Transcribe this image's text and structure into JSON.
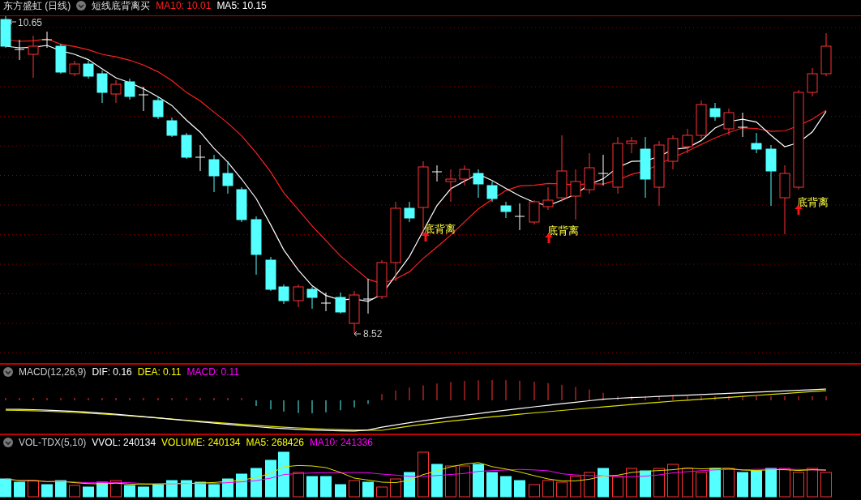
{
  "main": {
    "title": "东方盛虹 (日线)",
    "indicator": "短线底背离买",
    "legend": [
      {
        "text": "MA10: 10.01",
        "color": "#ff2020"
      },
      {
        "text": "MA5: 10.15",
        "color": "#ffffff"
      }
    ],
    "high_label": "10.65",
    "low_label": "8.52",
    "signals": [
      "底背离",
      "底背离",
      "底背离"
    ]
  },
  "macd": {
    "title": "MACD(12,26,9)",
    "legend": [
      {
        "text": "DIF: 0.16",
        "color": "#ffffff"
      },
      {
        "text": "DEA: 0.11",
        "color": "#ffff00"
      },
      {
        "text": "MACD: 0.11",
        "color": "#ff00ff"
      }
    ]
  },
  "volume": {
    "title": "VOL-TDX(5,10)",
    "legend": [
      {
        "text": "VVOL: 240134",
        "color": "#ffffff"
      },
      {
        "text": "VOLUME: 240134",
        "color": "#ffff00"
      },
      {
        "text": "MA5: 268426",
        "color": "#ffff00"
      },
      {
        "text": "MA10: 241336",
        "color": "#ff00ff"
      }
    ]
  }
}
